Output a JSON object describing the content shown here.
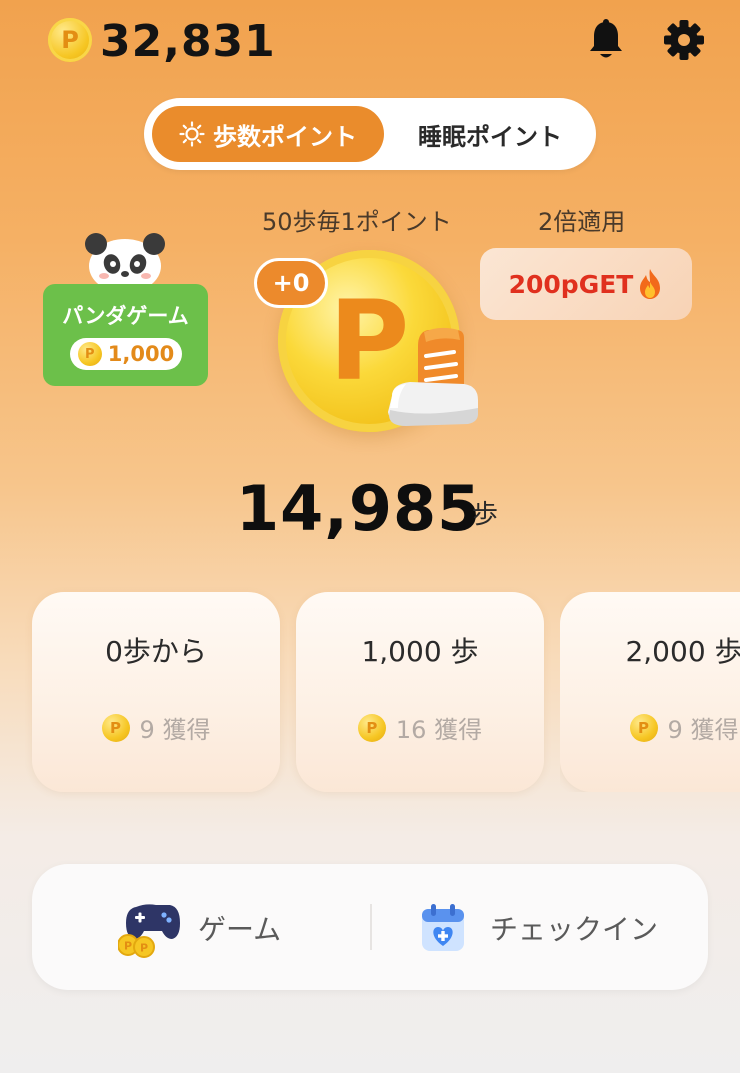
{
  "header": {
    "balance": "32,831",
    "coin_symbol": "P",
    "notification_icon": "bell-icon",
    "settings_icon": "gear-icon"
  },
  "mode_toggle": {
    "active_label": "歩数ポイント",
    "inactive_label": "睡眠ポイント",
    "active_icon": "sun-icon"
  },
  "rate": {
    "rule": "50歩毎1ポイント",
    "multiplier": "2倍適用",
    "badge": "200pGET",
    "badge_icon": "fire-icon"
  },
  "panda_game": {
    "title": "パンダゲーム",
    "points": "1,000"
  },
  "main_coin": {
    "symbol": "P",
    "gain": "+0"
  },
  "steps": {
    "count": "14,985",
    "unit": "歩"
  },
  "milestones": [
    {
      "label": "0歩から",
      "reward": "9 獲得"
    },
    {
      "label": "1,000 歩",
      "reward": "16 獲得"
    },
    {
      "label": "2,000 歩",
      "reward": "9 獲得"
    }
  ],
  "bottom_nav": {
    "game_label": "ゲーム",
    "checkin_label": "チェックイン"
  },
  "colors": {
    "accent": "#ea8c2c",
    "panda_card": "#6cc04a",
    "badge_text": "#e0301e"
  }
}
